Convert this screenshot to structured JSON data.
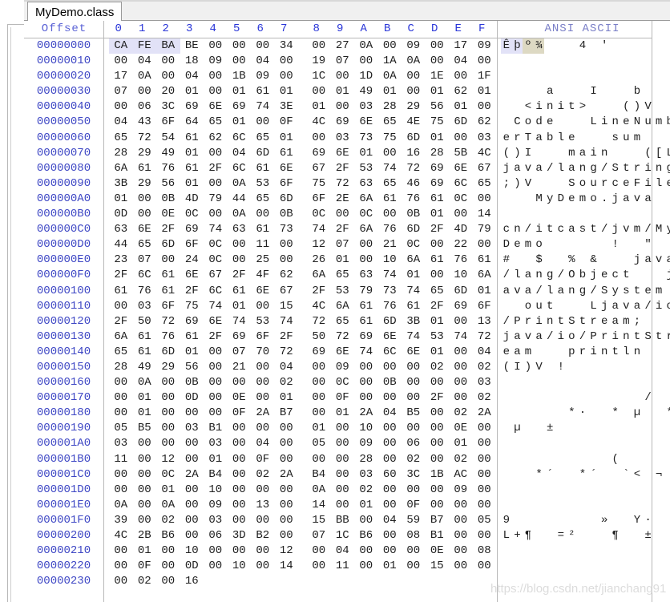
{
  "window": {
    "tab_label": "MyDemo.class"
  },
  "header": {
    "offset_label": "Offset",
    "columns": [
      "0",
      "1",
      "2",
      "3",
      "4",
      "5",
      "6",
      "7",
      "8",
      "9",
      "A",
      "B",
      "C",
      "D",
      "E",
      "F"
    ],
    "ascii_label": "ANSI ASCII"
  },
  "colors": {
    "offset_text": "#3d46c4",
    "header_text": "#2a36d8",
    "ascii_header_text": "#7a7fc7",
    "hex_text": "#202020",
    "selection": "#e2e2f7",
    "watermark": "#dcdcdc"
  },
  "watermark": "https://blog.csdn.net/jianchang91",
  "rows": [
    {
      "offset": "00000000",
      "bytes": [
        "CA",
        "FE",
        "BA",
        "BE",
        "00",
        "00",
        "00",
        "34",
        "00",
        "27",
        "0A",
        "00",
        "09",
        "00",
        "17",
        "09"
      ],
      "ascii": "Êþº¾   4 '"
    },
    {
      "offset": "00000010",
      "bytes": [
        "00",
        "04",
        "00",
        "18",
        "09",
        "00",
        "04",
        "00",
        "19",
        "07",
        "00",
        "1A",
        "0A",
        "00",
        "04",
        "00"
      ],
      "ascii": ""
    },
    {
      "offset": "00000020",
      "bytes": [
        "17",
        "0A",
        "00",
        "04",
        "00",
        "1B",
        "09",
        "00",
        "1C",
        "00",
        "1D",
        "0A",
        "00",
        "1E",
        "00",
        "1F"
      ],
      "ascii": ""
    },
    {
      "offset": "00000030",
      "bytes": [
        "07",
        "00",
        "20",
        "01",
        "00",
        "01",
        "61",
        "01",
        "00",
        "01",
        "49",
        "01",
        "00",
        "01",
        "62",
        "01"
      ],
      "ascii": "    a   I   b"
    },
    {
      "offset": "00000040",
      "bytes": [
        "00",
        "06",
        "3C",
        "69",
        "6E",
        "69",
        "74",
        "3E",
        "01",
        "00",
        "03",
        "28",
        "29",
        "56",
        "01",
        "00"
      ],
      "ascii": "  <init>   ()V"
    },
    {
      "offset": "00000050",
      "bytes": [
        "04",
        "43",
        "6F",
        "64",
        "65",
        "01",
        "00",
        "0F",
        "4C",
        "69",
        "6E",
        "65",
        "4E",
        "75",
        "6D",
        "62"
      ],
      "ascii": " Code   LineNumb"
    },
    {
      "offset": "00000060",
      "bytes": [
        "65",
        "72",
        "54",
        "61",
        "62",
        "6C",
        "65",
        "01",
        "00",
        "03",
        "73",
        "75",
        "6D",
        "01",
        "00",
        "03"
      ],
      "ascii": "erTable   sum"
    },
    {
      "offset": "00000070",
      "bytes": [
        "28",
        "29",
        "49",
        "01",
        "00",
        "04",
        "6D",
        "61",
        "69",
        "6E",
        "01",
        "00",
        "16",
        "28",
        "5B",
        "4C"
      ],
      "ascii": "()I   main   ([L"
    },
    {
      "offset": "00000080",
      "bytes": [
        "6A",
        "61",
        "76",
        "61",
        "2F",
        "6C",
        "61",
        "6E",
        "67",
        "2F",
        "53",
        "74",
        "72",
        "69",
        "6E",
        "67"
      ],
      "ascii": "java/lang/String"
    },
    {
      "offset": "00000090",
      "bytes": [
        "3B",
        "29",
        "56",
        "01",
        "00",
        "0A",
        "53",
        "6F",
        "75",
        "72",
        "63",
        "65",
        "46",
        "69",
        "6C",
        "65"
      ],
      "ascii": ";)V   SourceFile"
    },
    {
      "offset": "000000A0",
      "bytes": [
        "01",
        "00",
        "0B",
        "4D",
        "79",
        "44",
        "65",
        "6D",
        "6F",
        "2E",
        "6A",
        "61",
        "76",
        "61",
        "0C",
        "00"
      ],
      "ascii": "   MyDemo.java"
    },
    {
      "offset": "000000B0",
      "bytes": [
        "0D",
        "00",
        "0E",
        "0C",
        "00",
        "0A",
        "00",
        "0B",
        "0C",
        "00",
        "0C",
        "00",
        "0B",
        "01",
        "00",
        "14"
      ],
      "ascii": ""
    },
    {
      "offset": "000000C0",
      "bytes": [
        "63",
        "6E",
        "2F",
        "69",
        "74",
        "63",
        "61",
        "73",
        "74",
        "2F",
        "6A",
        "76",
        "6D",
        "2F",
        "4D",
        "79"
      ],
      "ascii": "cn/itcast/jvm/My"
    },
    {
      "offset": "000000D0",
      "bytes": [
        "44",
        "65",
        "6D",
        "6F",
        "0C",
        "00",
        "11",
        "00",
        "12",
        "07",
        "00",
        "21",
        "0C",
        "00",
        "22",
        "00"
      ],
      "ascii": "Demo      !  \""
    },
    {
      "offset": "000000E0",
      "bytes": [
        "23",
        "07",
        "00",
        "24",
        "0C",
        "00",
        "25",
        "00",
        "26",
        "01",
        "00",
        "10",
        "6A",
        "61",
        "76",
        "61"
      ],
      "ascii": "#  $  % &   java"
    },
    {
      "offset": "000000F0",
      "bytes": [
        "2F",
        "6C",
        "61",
        "6E",
        "67",
        "2F",
        "4F",
        "62",
        "6A",
        "65",
        "63",
        "74",
        "01",
        "00",
        "10",
        "6A"
      ],
      "ascii": "/lang/Object   j"
    },
    {
      "offset": "00000100",
      "bytes": [
        "61",
        "76",
        "61",
        "2F",
        "6C",
        "61",
        "6E",
        "67",
        "2F",
        "53",
        "79",
        "73",
        "74",
        "65",
        "6D",
        "01"
      ],
      "ascii": "ava/lang/System"
    },
    {
      "offset": "00000110",
      "bytes": [
        "00",
        "03",
        "6F",
        "75",
        "74",
        "01",
        "00",
        "15",
        "4C",
        "6A",
        "61",
        "76",
        "61",
        "2F",
        "69",
        "6F"
      ],
      "ascii": "  out   Ljava/io"
    },
    {
      "offset": "00000120",
      "bytes": [
        "2F",
        "50",
        "72",
        "69",
        "6E",
        "74",
        "53",
        "74",
        "72",
        "65",
        "61",
        "6D",
        "3B",
        "01",
        "00",
        "13"
      ],
      "ascii": "/PrintStream;"
    },
    {
      "offset": "00000130",
      "bytes": [
        "6A",
        "61",
        "76",
        "61",
        "2F",
        "69",
        "6F",
        "2F",
        "50",
        "72",
        "69",
        "6E",
        "74",
        "53",
        "74",
        "72"
      ],
      "ascii": "java/io/PrintStr"
    },
    {
      "offset": "00000140",
      "bytes": [
        "65",
        "61",
        "6D",
        "01",
        "00",
        "07",
        "70",
        "72",
        "69",
        "6E",
        "74",
        "6C",
        "6E",
        "01",
        "00",
        "04"
      ],
      "ascii": "eam   println"
    },
    {
      "offset": "00000150",
      "bytes": [
        "28",
        "49",
        "29",
        "56",
        "00",
        "21",
        "00",
        "04",
        "00",
        "09",
        "00",
        "00",
        "00",
        "02",
        "00",
        "02"
      ],
      "ascii": "(I)V !"
    },
    {
      "offset": "00000160",
      "bytes": [
        "00",
        "0A",
        "00",
        "0B",
        "00",
        "00",
        "00",
        "02",
        "00",
        "0C",
        "00",
        "0B",
        "00",
        "00",
        "00",
        "03"
      ],
      "ascii": ""
    },
    {
      "offset": "00000170",
      "bytes": [
        "00",
        "01",
        "00",
        "0D",
        "00",
        "0E",
        "00",
        "01",
        "00",
        "0F",
        "00",
        "00",
        "00",
        "2F",
        "00",
        "02"
      ],
      "ascii": "             /"
    },
    {
      "offset": "00000180",
      "bytes": [
        "00",
        "01",
        "00",
        "00",
        "00",
        "0F",
        "2A",
        "B7",
        "00",
        "01",
        "2A",
        "04",
        "B5",
        "00",
        "02",
        "2A"
      ],
      "ascii": "      *·  * µ  *"
    },
    {
      "offset": "00000190",
      "bytes": [
        "05",
        "B5",
        "00",
        "03",
        "B1",
        "00",
        "00",
        "00",
        "01",
        "00",
        "10",
        "00",
        "00",
        "00",
        "0E",
        "00"
      ],
      "ascii": " µ  ±"
    },
    {
      "offset": "000001A0",
      "bytes": [
        "03",
        "00",
        "00",
        "00",
        "03",
        "00",
        "04",
        "00",
        "05",
        "00",
        "09",
        "00",
        "06",
        "00",
        "01",
        "00"
      ],
      "ascii": ""
    },
    {
      "offset": "000001B0",
      "bytes": [
        "11",
        "00",
        "12",
        "00",
        "01",
        "00",
        "0F",
        "00",
        "00",
        "00",
        "28",
        "00",
        "02",
        "00",
        "02",
        "00"
      ],
      "ascii": "          ("
    },
    {
      "offset": "000001C0",
      "bytes": [
        "00",
        "00",
        "0C",
        "2A",
        "B4",
        "00",
        "02",
        "2A",
        "B4",
        "00",
        "03",
        "60",
        "3C",
        "1B",
        "AC",
        "00"
      ],
      "ascii": "   *´  *´  `< ¬"
    },
    {
      "offset": "000001D0",
      "bytes": [
        "00",
        "00",
        "01",
        "00",
        "10",
        "00",
        "00",
        "00",
        "0A",
        "00",
        "02",
        "00",
        "00",
        "00",
        "09",
        "00"
      ],
      "ascii": ""
    },
    {
      "offset": "000001E0",
      "bytes": [
        "0A",
        "00",
        "0A",
        "00",
        "09",
        "00",
        "13",
        "00",
        "14",
        "00",
        "01",
        "00",
        "0F",
        "00",
        "00",
        "00"
      ],
      "ascii": ""
    },
    {
      "offset": "000001F0",
      "bytes": [
        "39",
        "00",
        "02",
        "00",
        "03",
        "00",
        "00",
        "00",
        "15",
        "BB",
        "00",
        "04",
        "59",
        "B7",
        "00",
        "05"
      ],
      "ascii": "9        »  Y·"
    },
    {
      "offset": "00000200",
      "bytes": [
        "4C",
        "2B",
        "B6",
        "00",
        "06",
        "3D",
        "B2",
        "00",
        "07",
        "1C",
        "B6",
        "00",
        "08",
        "B1",
        "00",
        "00"
      ],
      "ascii": "L+¶  =²   ¶  ±"
    },
    {
      "offset": "00000210",
      "bytes": [
        "00",
        "01",
        "00",
        "10",
        "00",
        "00",
        "00",
        "12",
        "00",
        "04",
        "00",
        "00",
        "00",
        "0E",
        "00",
        "08"
      ],
      "ascii": ""
    },
    {
      "offset": "00000220",
      "bytes": [
        "00",
        "0F",
        "00",
        "0D",
        "00",
        "10",
        "00",
        "14",
        "00",
        "11",
        "00",
        "01",
        "00",
        "15",
        "00",
        "00"
      ],
      "ascii": ""
    },
    {
      "offset": "00000230",
      "bytes": [
        "00",
        "02",
        "00",
        "16"
      ],
      "ascii": ""
    }
  ]
}
